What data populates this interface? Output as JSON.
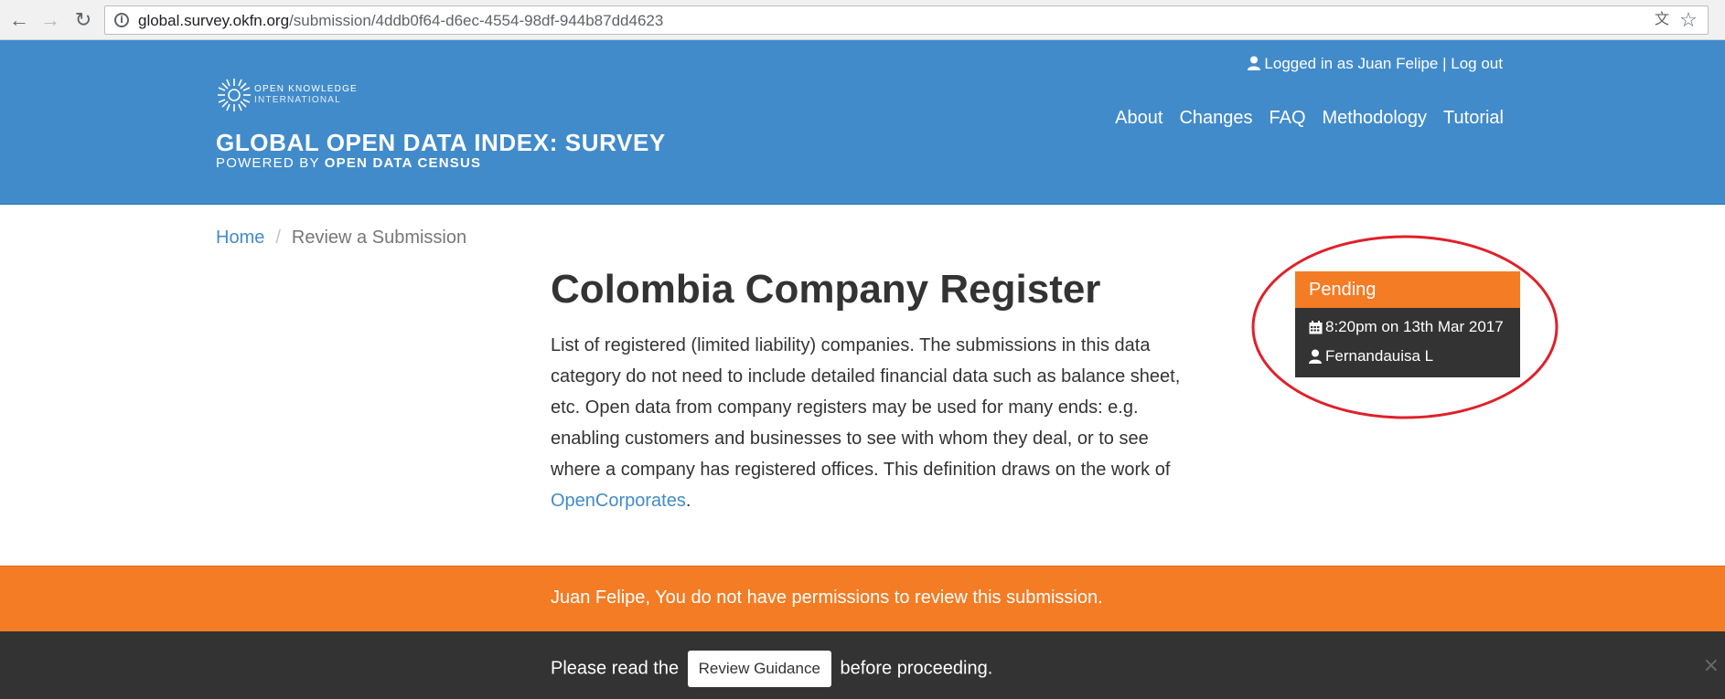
{
  "browser": {
    "url_host": "global.survey.okfn.org",
    "url_path": "/submission/4ddb0f64-d6ec-4554-98df-944b87dd4623"
  },
  "header": {
    "logo_line1": "OPEN KNOWLEDGE",
    "logo_line2": "INTERNATIONAL",
    "title": "GLOBAL OPEN DATA INDEX: SURVEY",
    "subtitle_plain": "POWERED BY ",
    "subtitle_strong": "OPEN DATA CENSUS",
    "logged_in_text": "Logged in as Juan Felipe",
    "separator": " | ",
    "logout_label": "Log out",
    "nav": [
      "About",
      "Changes",
      "FAQ",
      "Methodology",
      "Tutorial"
    ]
  },
  "breadcrumb": {
    "home": "Home",
    "separator": "/",
    "current": "Review a Submission"
  },
  "main": {
    "title": "Colombia Company Register",
    "description": "List of registered (limited liability) companies. The submissions in this data category do not need to include detailed financial data such as balance sheet, etc. Open data from company registers may be used for many ends: e.g. enabling customers and businesses to see with whom they deal, or to see where a company has registered offices. This definition draws on the work of ",
    "link_text": "OpenCorporates",
    "description_end": "."
  },
  "status": {
    "label": "Pending",
    "datetime": "8:20pm on 13th Mar 2017",
    "submitter": "Fernandauisa L",
    "header_color": "#f37c25",
    "body_color": "#333333",
    "highlight_color": "#e0202a"
  },
  "alert": {
    "text": "Juan Felipe, You do not have permissions to review this submission."
  },
  "notice": {
    "before": "Please read the ",
    "button_label": "Review Guidance",
    "after": " before proceeding.",
    "close": "×"
  },
  "colors": {
    "brand_blue": "#428bca",
    "accent_orange": "#f37c25",
    "dark": "#333333"
  }
}
